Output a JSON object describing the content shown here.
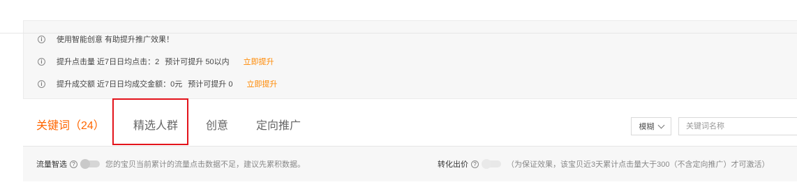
{
  "tips": [
    {
      "text": "使用智能创意  有助提升推广效果！"
    },
    {
      "text": "提升点击量  近7日日均点击：2",
      "extra": "预计可提升 50以内",
      "link": "立即提升"
    },
    {
      "text": "提升成交额  近7日日均成交金额：0元",
      "extra": "预计可提升 0",
      "link": "立即提升"
    }
  ],
  "info_icon_glyph": "i",
  "tabs": [
    {
      "label": "关键词（24）",
      "active": true
    },
    {
      "label": "精选人群",
      "active": false
    },
    {
      "label": "创意",
      "active": false
    },
    {
      "label": "定向推广",
      "active": false
    }
  ],
  "search": {
    "match_select": "模糊",
    "keyword_placeholder": "关键词名称"
  },
  "settings": {
    "traffic_label": "流量智选",
    "traffic_desc": "您的宝贝当前累计的流量点击数据不足，建议先累积数据。",
    "conversion_label": "转化出价",
    "conversion_desc": "（为保证效果，该宝贝近3天累计点击量大于300（不含定向推广）才可激活）"
  },
  "colors": {
    "accent": "#ff6600",
    "link": "#ff8800",
    "highlight_border": "#e3131b"
  }
}
